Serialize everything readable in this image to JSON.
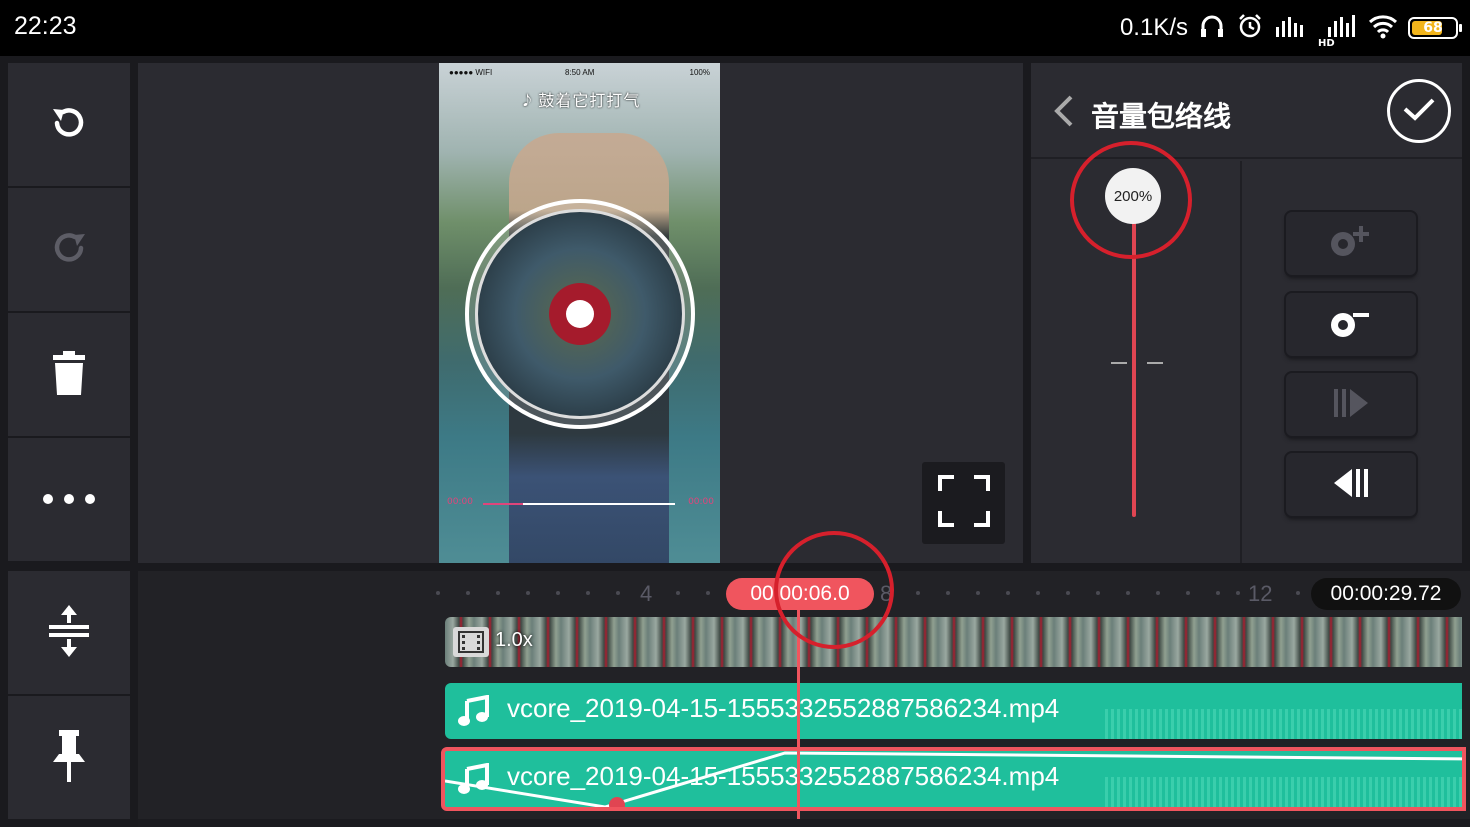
{
  "status_bar": {
    "time": "22:23",
    "net_speed": "0.1K/s",
    "battery": "68",
    "hd": "HD"
  },
  "left_tools": {
    "items": [
      {
        "name": "undo",
        "icon": "undo-icon"
      },
      {
        "name": "redo",
        "icon": "redo-icon"
      },
      {
        "name": "delete",
        "icon": "trash-icon"
      },
      {
        "name": "more",
        "icon": "more-icon"
      }
    ]
  },
  "left_tools_bottom": {
    "items": [
      {
        "name": "split-expand",
        "icon": "expand-vertical-icon"
      },
      {
        "name": "pin",
        "icon": "pin-icon"
      }
    ]
  },
  "preview": {
    "status_left": "●●●●● WIFI",
    "status_time": "8:50 AM",
    "status_battery": "100%",
    "caption": "𝅘𝅥𝅮 鼓着它打打气",
    "progress_start": "00:00",
    "progress_end": "00:00",
    "fullscreen_icon": "fullscreen-icon"
  },
  "volume_panel": {
    "title": "音量包络线",
    "back_icon": "chevron-left-icon",
    "confirm_icon": "check-icon",
    "volume_label": "200%",
    "volume_value": 2.0,
    "buttons": [
      {
        "name": "add-keyframe",
        "icon": "keyframe-add-icon",
        "enabled": false
      },
      {
        "name": "remove-keyframe",
        "icon": "keyframe-remove-icon",
        "enabled": true
      },
      {
        "name": "next-keyframe",
        "icon": "next-keyframe-icon",
        "enabled": false
      },
      {
        "name": "prev-keyframe",
        "icon": "prev-keyframe-icon",
        "enabled": true
      }
    ],
    "accent_color": "#e04552"
  },
  "timeline": {
    "ruler_labels": [
      "4",
      "8",
      "12"
    ],
    "current_time": "00:00:06.0",
    "duration": "00:00:29.72",
    "video_speed": "1.0x",
    "audio_tracks": [
      {
        "label": "vcore_2019-04-15-1555332552887586234.mp4",
        "selected": false
      },
      {
        "label": "vcore_2019-04-15-1555332552887586234.mp4",
        "selected": true
      }
    ],
    "audio_color": "#1fbf9c",
    "playhead_color": "#f0555e"
  }
}
